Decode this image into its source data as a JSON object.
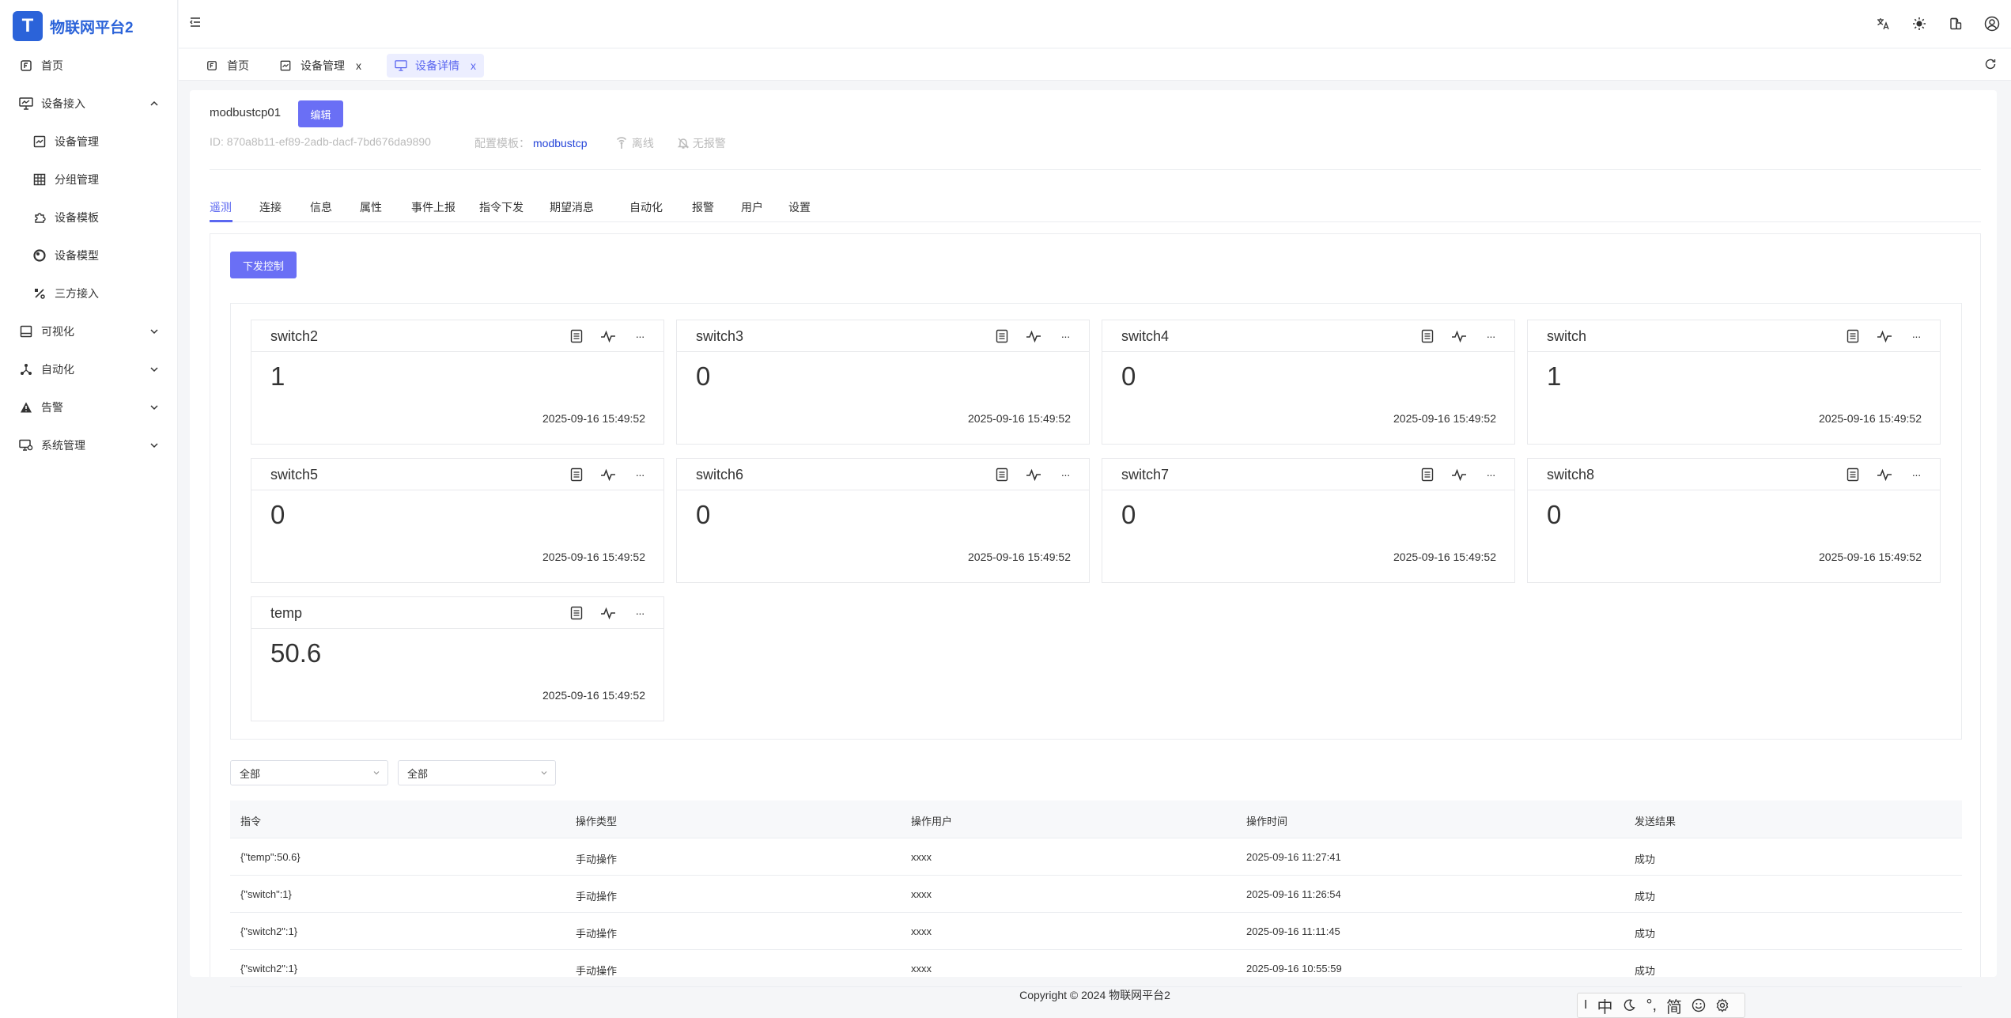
{
  "brand": {
    "title": "物联网平台2",
    "logo_letter": "T"
  },
  "sidebar": {
    "items": [
      {
        "label": "首页",
        "icon": "home-doc-icon",
        "expanded": null
      },
      {
        "label": "设备接入",
        "icon": "monitor-icon",
        "expanded": true
      },
      {
        "label": "设备管理",
        "icon": "device-chart-icon",
        "sub": true
      },
      {
        "label": "分组管理",
        "icon": "grid-icon",
        "sub": true
      },
      {
        "label": "设备模板",
        "icon": "puzzle-icon",
        "sub": true
      },
      {
        "label": "设备模型",
        "icon": "circle-model-icon",
        "sub": true
      },
      {
        "label": "三方接入",
        "icon": "percent-icon",
        "sub": true
      },
      {
        "label": "可视化",
        "icon": "screen-icon",
        "expanded": false
      },
      {
        "label": "自动化",
        "icon": "network-icon",
        "expanded": false
      },
      {
        "label": "告警",
        "icon": "warning-icon",
        "expanded": false
      },
      {
        "label": "系统管理",
        "icon": "system-icon",
        "expanded": false
      }
    ]
  },
  "tabs": [
    {
      "label": "首页",
      "closable": false,
      "active": false
    },
    {
      "label": "设备管理",
      "closable": true,
      "active": false
    },
    {
      "label": "设备详情",
      "closable": true,
      "active": true
    }
  ],
  "tab_close_glyph": "x",
  "device": {
    "name": "modbustcp01",
    "edit_label": "编辑",
    "id_label": "ID:",
    "id_value": "870a8b11-ef89-2adb-dacf-7bd676da9890",
    "template_label": "配置模板：",
    "template_value": "modbustcp",
    "status_offline": "离线",
    "status_alarm": "无报警"
  },
  "sub_tabs": [
    "遥测",
    "连接",
    "信息",
    "属性",
    "事件上报",
    "指令下发",
    "期望消息",
    "自动化",
    "报警",
    "用户",
    "设置"
  ],
  "active_sub_tab": "遥测",
  "control_button": "下发控制",
  "telemetry": [
    {
      "name": "switch2",
      "value": "1",
      "time": "2025-09-16 15:49:52"
    },
    {
      "name": "switch3",
      "value": "0",
      "time": "2025-09-16 15:49:52"
    },
    {
      "name": "switch4",
      "value": "0",
      "time": "2025-09-16 15:49:52"
    },
    {
      "name": "switch",
      "value": "1",
      "time": "2025-09-16 15:49:52"
    },
    {
      "name": "switch5",
      "value": "0",
      "time": "2025-09-16 15:49:52"
    },
    {
      "name": "switch6",
      "value": "0",
      "time": "2025-09-16 15:49:52"
    },
    {
      "name": "switch7",
      "value": "0",
      "time": "2025-09-16 15:49:52"
    },
    {
      "name": "switch8",
      "value": "0",
      "time": "2025-09-16 15:49:52"
    },
    {
      "name": "temp",
      "value": "50.6",
      "time": "2025-09-16 15:49:52"
    }
  ],
  "more_glyph": "···",
  "filters": {
    "filter1": "全部",
    "filter2": "全部"
  },
  "table": {
    "headers": [
      "指令",
      "操作类型",
      "操作用户",
      "操作时间",
      "发送结果"
    ],
    "rows": [
      [
        "{\"temp\":50.6}",
        "手动操作",
        "xxxx",
        "2025-09-16 11:27:41",
        "成功"
      ],
      [
        "{\"switch\":1}",
        "手动操作",
        "xxxx",
        "2025-09-16 11:26:54",
        "成功"
      ],
      [
        "{\"switch2\":1}",
        "手动操作",
        "xxxx",
        "2025-09-16 11:11:45",
        "成功"
      ],
      [
        "{\"switch2\":1}",
        "手动操作",
        "xxxx",
        "2025-09-16 10:55:59",
        "成功"
      ]
    ]
  },
  "footer": "Copyright © 2024 物联网平台2",
  "ime": {
    "cursor": "I",
    "lang": "中",
    "punct": "°,",
    "mode": "简"
  },
  "colors": {
    "primary": "#6a6ff5",
    "brand": "#2b63d9",
    "link": "#2343d8"
  }
}
